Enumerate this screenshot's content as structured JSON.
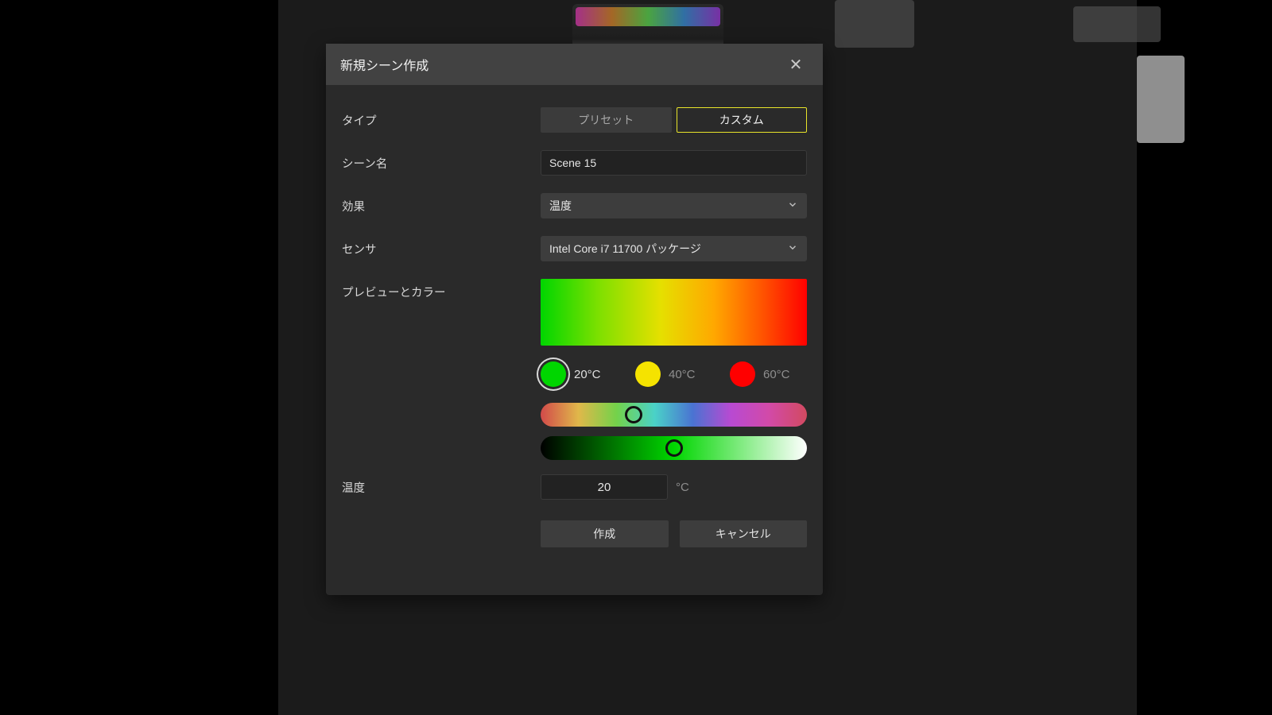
{
  "modal": {
    "title": "新規シーン作成",
    "labels": {
      "type": "タイプ",
      "scene_name": "シーン名",
      "effect": "効果",
      "sensor": "センサ",
      "preview_color": "プレビューとカラー",
      "temperature": "温度"
    },
    "type_options": {
      "preset": "プリセット",
      "custom": "カスタム"
    },
    "scene_name_value": "Scene 15",
    "effect_value": "温度",
    "sensor_value": "Intel Core i7 11700 パッケージ",
    "color_stops": [
      {
        "color": "#00d600",
        "label": "20°C",
        "selected": true
      },
      {
        "color": "#f5e300",
        "label": "40°C",
        "selected": false
      },
      {
        "color": "#ff0000",
        "label": "60°C",
        "selected": false
      }
    ],
    "hue_handle_pct": 35,
    "light_handle_pct": 50,
    "temperature_value": "20",
    "temperature_unit": "°C",
    "buttons": {
      "create": "作成",
      "cancel": "キャンセル"
    }
  }
}
